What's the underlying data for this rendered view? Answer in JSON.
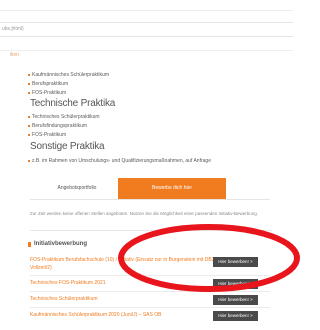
{
  "browser": {
    "url_fragment": "ubs.jhtml)"
  },
  "breadcrumb": {
    "home": "ilien"
  },
  "lists": {
    "first": [
      "Kaufmännisches Schülerpraktikum",
      "Berufspraktikum",
      "FOS-Praktikum"
    ],
    "technical_heading": "Technische Praktika",
    "technical": [
      "Technisches Schülerpraktikum",
      "Berufsfindungspraktikum",
      "FOS-Praktikum"
    ],
    "other_heading": "Sonstige Praktika",
    "other": [
      "z.B. im Rahmen von Umschulungs- und Qualifizierungsmaßnahmen, auf Anfrage"
    ]
  },
  "tabs": {
    "inactive": "Angebotsportfolio",
    "active": "Bewerbe dich hier"
  },
  "info_text": "Zur Zeit werden keine offenen Stellen angeboten. Nutzen Sie die Möglichkeit einer passenden Initiativ-Bewerbung.",
  "section_title": "Initiativbewerbung",
  "jobs": [
    {
      "title_line1": "FOS-Praktikum Berufsfachschule (10) / Initiativ (Einsatz nur in Burgenstein mit DB2",
      "title_line2": "Vollzeit/2)",
      "button": "Hier bewerben! >"
    },
    {
      "title_line1": "Technisches FOS-Praktikum 2021",
      "title_line2": "",
      "button": "Hier bewerben! >"
    },
    {
      "title_line1": "Technisches Schülerpraktikum",
      "title_line2": "",
      "button": "Hier bewerben! >"
    },
    {
      "title_line1": "Kaufmännisches Schülerpraktikum 2020 (Juni/J) – SAS OB",
      "title_line2": "",
      "button": "Hier bewerben! >"
    }
  ],
  "colors": {
    "accent": "#f07c1f",
    "button_dark": "#4a4a4a",
    "annotation": "#e8161c"
  }
}
